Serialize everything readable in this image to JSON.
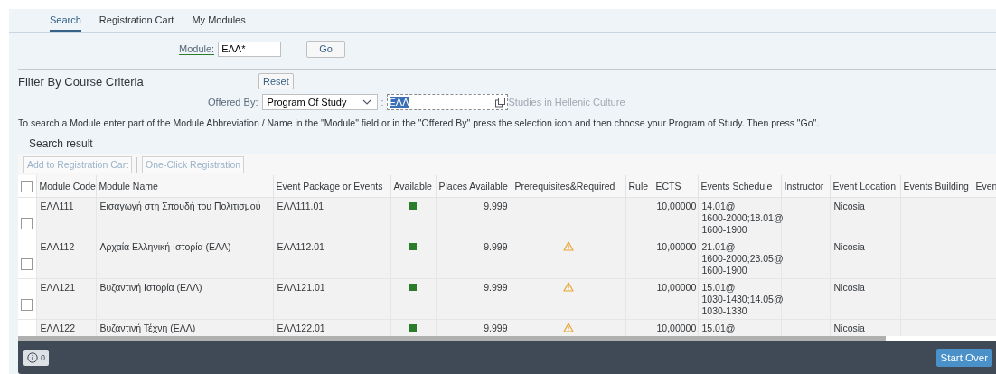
{
  "tabs": [
    {
      "label": "Search",
      "selected": true
    },
    {
      "label": "Registration Cart",
      "selected": false
    },
    {
      "label": "My Modules",
      "selected": false
    }
  ],
  "module_search": {
    "label": "Module:",
    "value": "ΕΛΛ*",
    "button": "Go"
  },
  "filter": {
    "title": "Filter By Course Criteria",
    "reset_button": "Reset",
    "offered_by_label": "Offered By:",
    "offered_by_value": "Program Of Study",
    "separator": ":",
    "code_value": "ΕΛΛ",
    "code_highlighted": true,
    "code_description": "Studies in Hellenic Culture"
  },
  "instruction": "To search a Module enter part of the Module Abbreviation / Name in the \"Module\" field or in the \"Offered By\" press the selection icon and then choose your Program of Study. Then press \"Go\".",
  "results": {
    "title": "Search result",
    "toolbar": [
      {
        "label": "Add to Registration Cart",
        "disabled": true
      },
      {
        "label": "One-Click Registration",
        "disabled": true
      }
    ],
    "select_all_checked": false,
    "columns": [
      "Module Code",
      "Module Name",
      "Event Package or Events",
      "Available",
      "Places Available",
      "Prerequisites&Required",
      "Rule",
      "ECTS",
      "Events Schedule",
      "Instructor",
      "Event Location",
      "Events Building",
      "Even"
    ],
    "rows": [
      {
        "checked": false,
        "code": "ΕΛΛ111",
        "name": "Εισαγωγή στη Σπουδή του Πολιτισμού",
        "event": "ΕΛΛ111.01",
        "available": true,
        "places": "9.999",
        "prerequisites_warning": false,
        "ects": "10,00000",
        "schedule": [
          "14.01@",
          "1600-2000;18.01@",
          "1600-1900"
        ],
        "location": "Nicosia"
      },
      {
        "checked": false,
        "code": "ΕΛΛ112",
        "name": "Αρχαία Ελληνική Ιστορία (ΕΛΛ)",
        "event": "ΕΛΛ112.01",
        "available": true,
        "places": "9.999",
        "prerequisites_warning": true,
        "ects": "10,00000",
        "schedule": [
          "21.01@",
          "1600-2000;23.05@",
          "1600-1900"
        ],
        "location": "Nicosia"
      },
      {
        "checked": false,
        "code": "ΕΛΛ121",
        "name": "Βυζαντινή Ιστορία (ΕΛΛ)",
        "event": "ΕΛΛ121.01",
        "available": true,
        "places": "9.999",
        "prerequisites_warning": true,
        "ects": "10,00000",
        "schedule": [
          "15.01@",
          "1030-1430;14.05@",
          "1030-1330"
        ],
        "location": "Nicosia"
      },
      {
        "code": "ΕΛΛ122",
        "name": "Βυζαντινή Τέχνη (ΕΛΛ)",
        "event": "ΕΛΛ122.01",
        "available": true,
        "places": "9.999",
        "prerequisites_warning": true,
        "ects": "10,00000",
        "schedule": [
          "15.01@"
        ],
        "location": "Nicosia"
      }
    ]
  },
  "footer": {
    "message_count": "0",
    "start_over_button": "Start Over"
  }
}
